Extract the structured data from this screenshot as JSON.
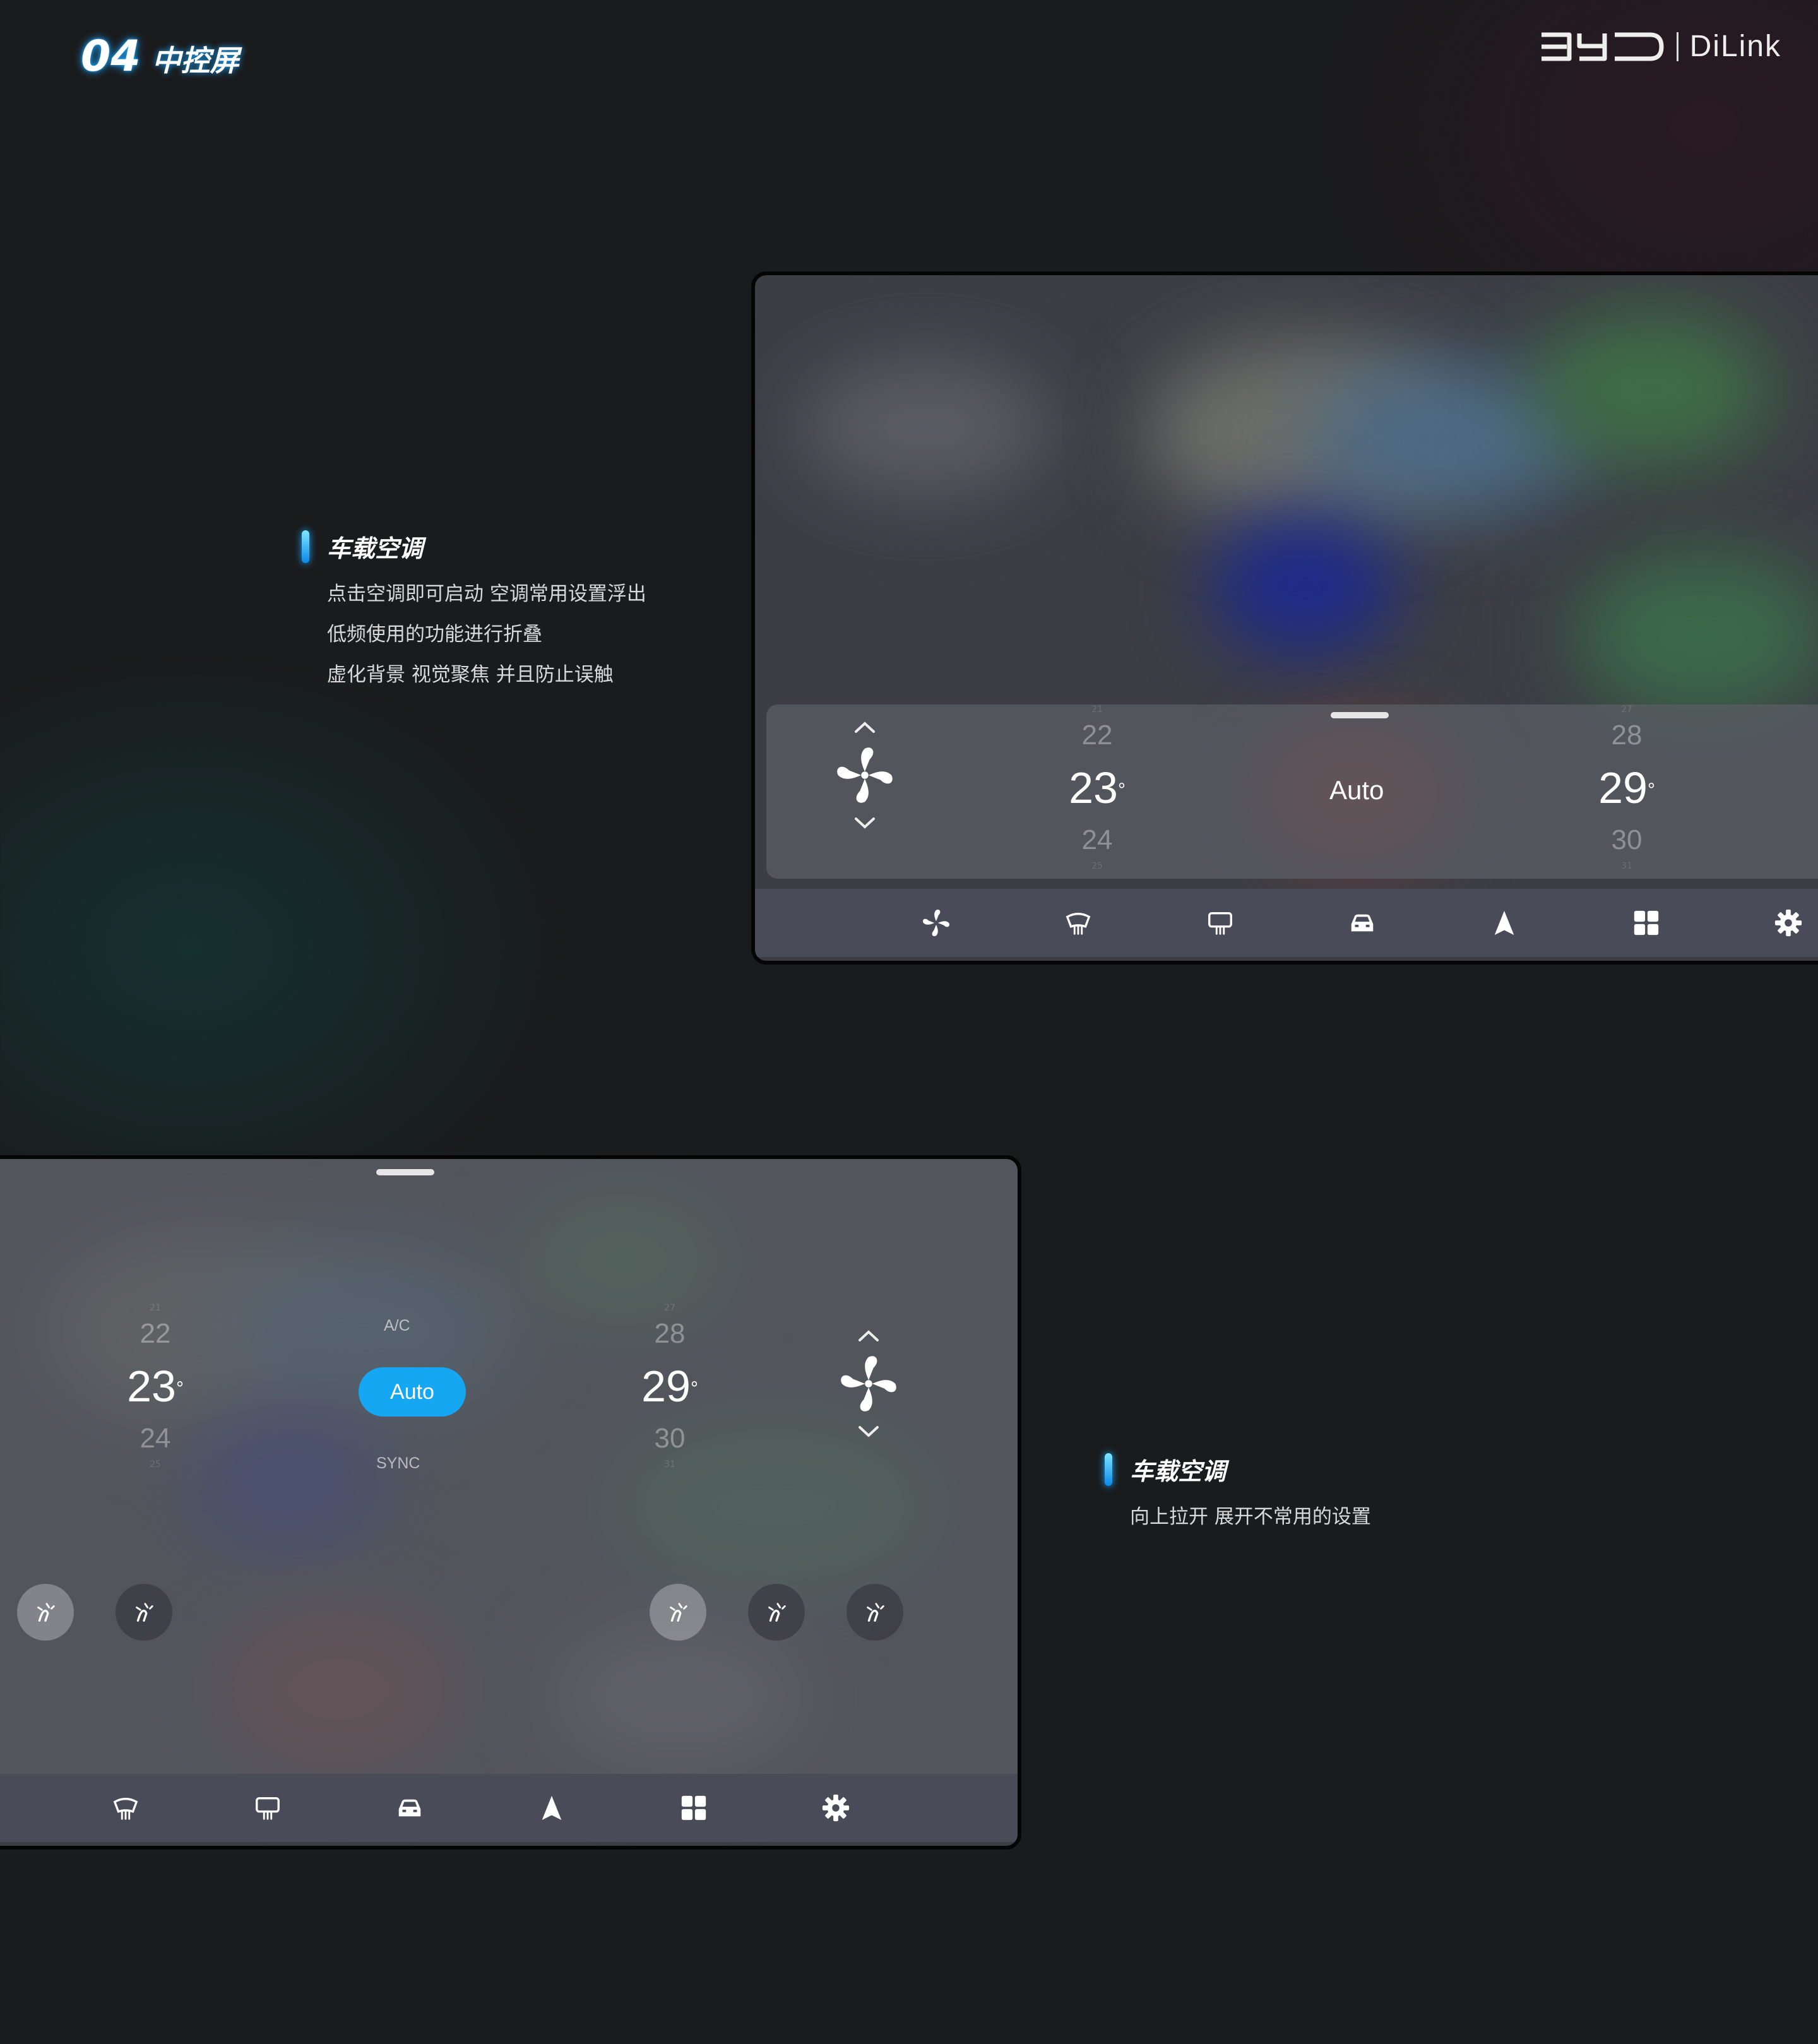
{
  "header": {
    "section_number": "04",
    "section_title": "中控屏",
    "brand_separator": "|",
    "brand_product": "DiLink"
  },
  "desc_top": {
    "title": "车载空调",
    "lines": [
      "点击空调即可启动 空调常用设置浮出",
      "低频使用的功能进行折叠",
      "虚化背景 视觉聚焦 并且防止误触"
    ]
  },
  "desc_bottom": {
    "title": "车载空调",
    "lines": [
      "向上拉开 展开不常用的设置"
    ]
  },
  "screen_top": {
    "left_temp": {
      "above_faint": "21",
      "up": "22",
      "main": "23",
      "down": "24",
      "below_faint": "25"
    },
    "mode": "Auto",
    "right_temp": {
      "above_faint": "27",
      "up": "28",
      "main": "29",
      "down": "30",
      "below_faint": "31"
    },
    "degree": "°",
    "dock_icons": [
      "fan-icon",
      "front-defrost-icon",
      "rear-defrost-icon",
      "car-icon",
      "navigation-icon",
      "apps-icon",
      "settings-icon"
    ]
  },
  "screen_bottom": {
    "left_temp": {
      "above_faint": "21",
      "up": "22",
      "main": "23",
      "down": "24",
      "below_faint": "25"
    },
    "ac_label": "A/C",
    "mode": "Auto",
    "sync_label": "SYNC",
    "right_temp": {
      "above_faint": "27",
      "up": "28",
      "main": "29",
      "down": "30",
      "below_faint": "31"
    },
    "degree": "°",
    "dock_icons": [
      "front-defrost-icon",
      "rear-defrost-icon",
      "car-icon",
      "navigation-icon",
      "apps-icon",
      "settings-icon"
    ]
  },
  "colors": {
    "accent": "#16a7f2",
    "background": "#1a1b1d",
    "dock": "#4a4b58"
  }
}
